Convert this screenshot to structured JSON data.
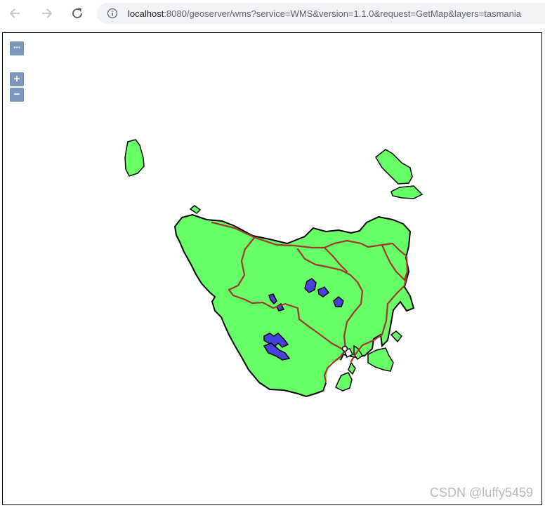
{
  "browser": {
    "url_host": "localhost",
    "url_rest": ":8080/geoserver/wms?service=WMS&version=1.1.0&request=GetMap&layers=tasmania",
    "back_icon": "arrow-left-icon",
    "forward_icon": "arrow-right-icon",
    "reload_icon": "reload-icon",
    "info_icon": "info-icon"
  },
  "map_controls": {
    "options_label": "···",
    "zoom_in_label": "+",
    "zoom_out_label": "−"
  },
  "map_colors": {
    "land": "#66ff66",
    "water": "#4444dd",
    "roads": "#a0382e",
    "outline": "#000000",
    "control": "#7b98bc"
  },
  "watermark": "CSDN @luffy5459"
}
